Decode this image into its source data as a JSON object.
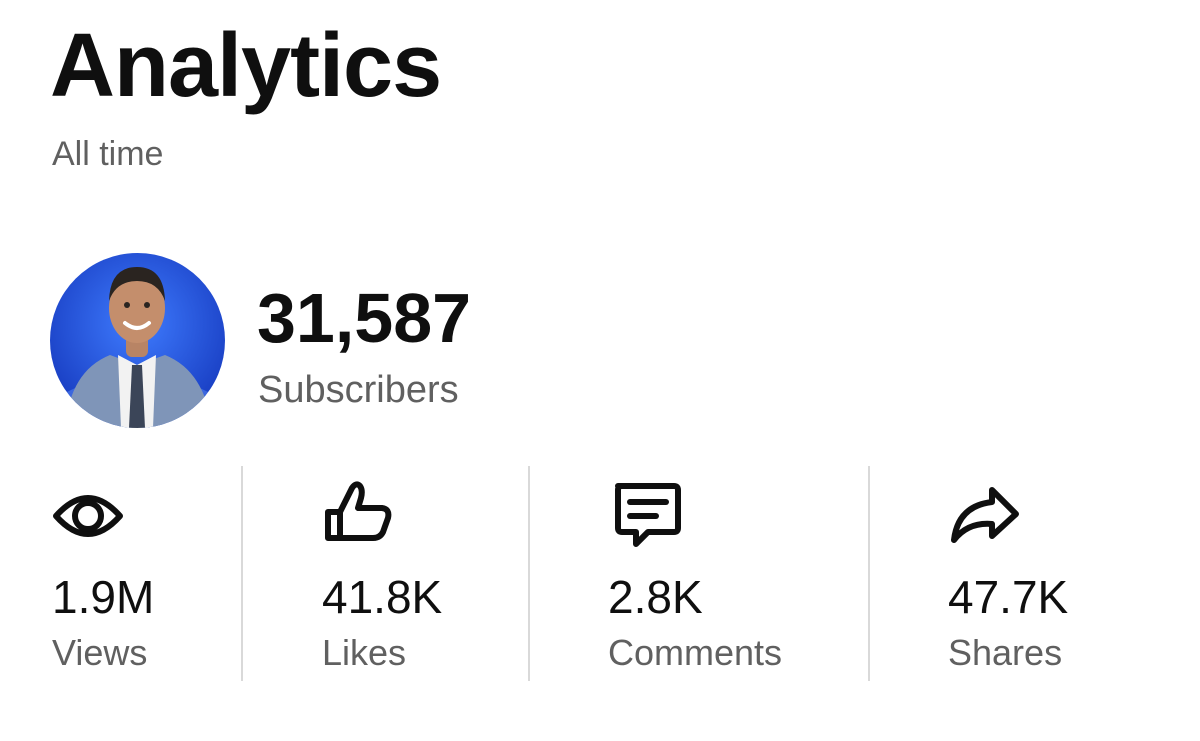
{
  "header": {
    "title": "Analytics",
    "period": "All time"
  },
  "channel": {
    "avatar_alt": "channel-avatar",
    "subscriber_count": "31,587",
    "subscriber_label": "Subscribers"
  },
  "stats": [
    {
      "icon": "eye-icon",
      "value": "1.9M",
      "label": "Views"
    },
    {
      "icon": "thumbs-up-icon",
      "value": "41.8K",
      "label": "Likes"
    },
    {
      "icon": "comment-icon",
      "value": "2.8K",
      "label": "Comments"
    },
    {
      "icon": "share-icon",
      "value": "47.7K",
      "label": "Shares"
    }
  ],
  "colors": {
    "text_primary": "#0f0f0f",
    "text_secondary": "#606060",
    "divider": "#d9d9d9",
    "avatar_background": "#1e4fd6"
  }
}
